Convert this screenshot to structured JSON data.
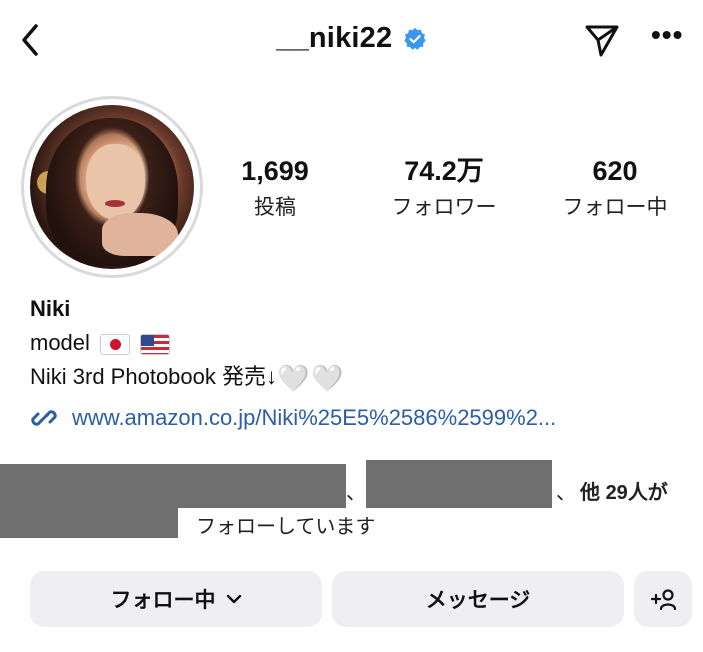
{
  "header": {
    "username": "__niki22",
    "verified": true,
    "accent_color": "#3897f0"
  },
  "profile": {
    "stats": [
      {
        "value": "1,699",
        "label": "投稿"
      },
      {
        "value": "74.2万",
        "label": "フォロワー"
      },
      {
        "value": "620",
        "label": "フォロー中"
      }
    ],
    "name": "Niki",
    "bio_line1": "model",
    "bio_line2": "Niki 3rd Photobook 発売↓",
    "hearts": "🤍🤍",
    "link": "www.amazon.co.jp/Niki%25E5%2586%2599%2...",
    "link_color": "#2a5ea8"
  },
  "followed_by": {
    "separator1": "、",
    "separator2": "、",
    "others_prefix": "他",
    "others_count": "29",
    "others_suffix": "人が",
    "line2": "フォローしています"
  },
  "actions": {
    "follow_label": "フォロー中",
    "message_label": "メッセージ"
  },
  "icons": [
    "back-chevron-icon",
    "verified-badge-icon",
    "send-direct-icon",
    "more-options-icon",
    "link-icon",
    "chevron-down-icon",
    "add-person-icon"
  ]
}
